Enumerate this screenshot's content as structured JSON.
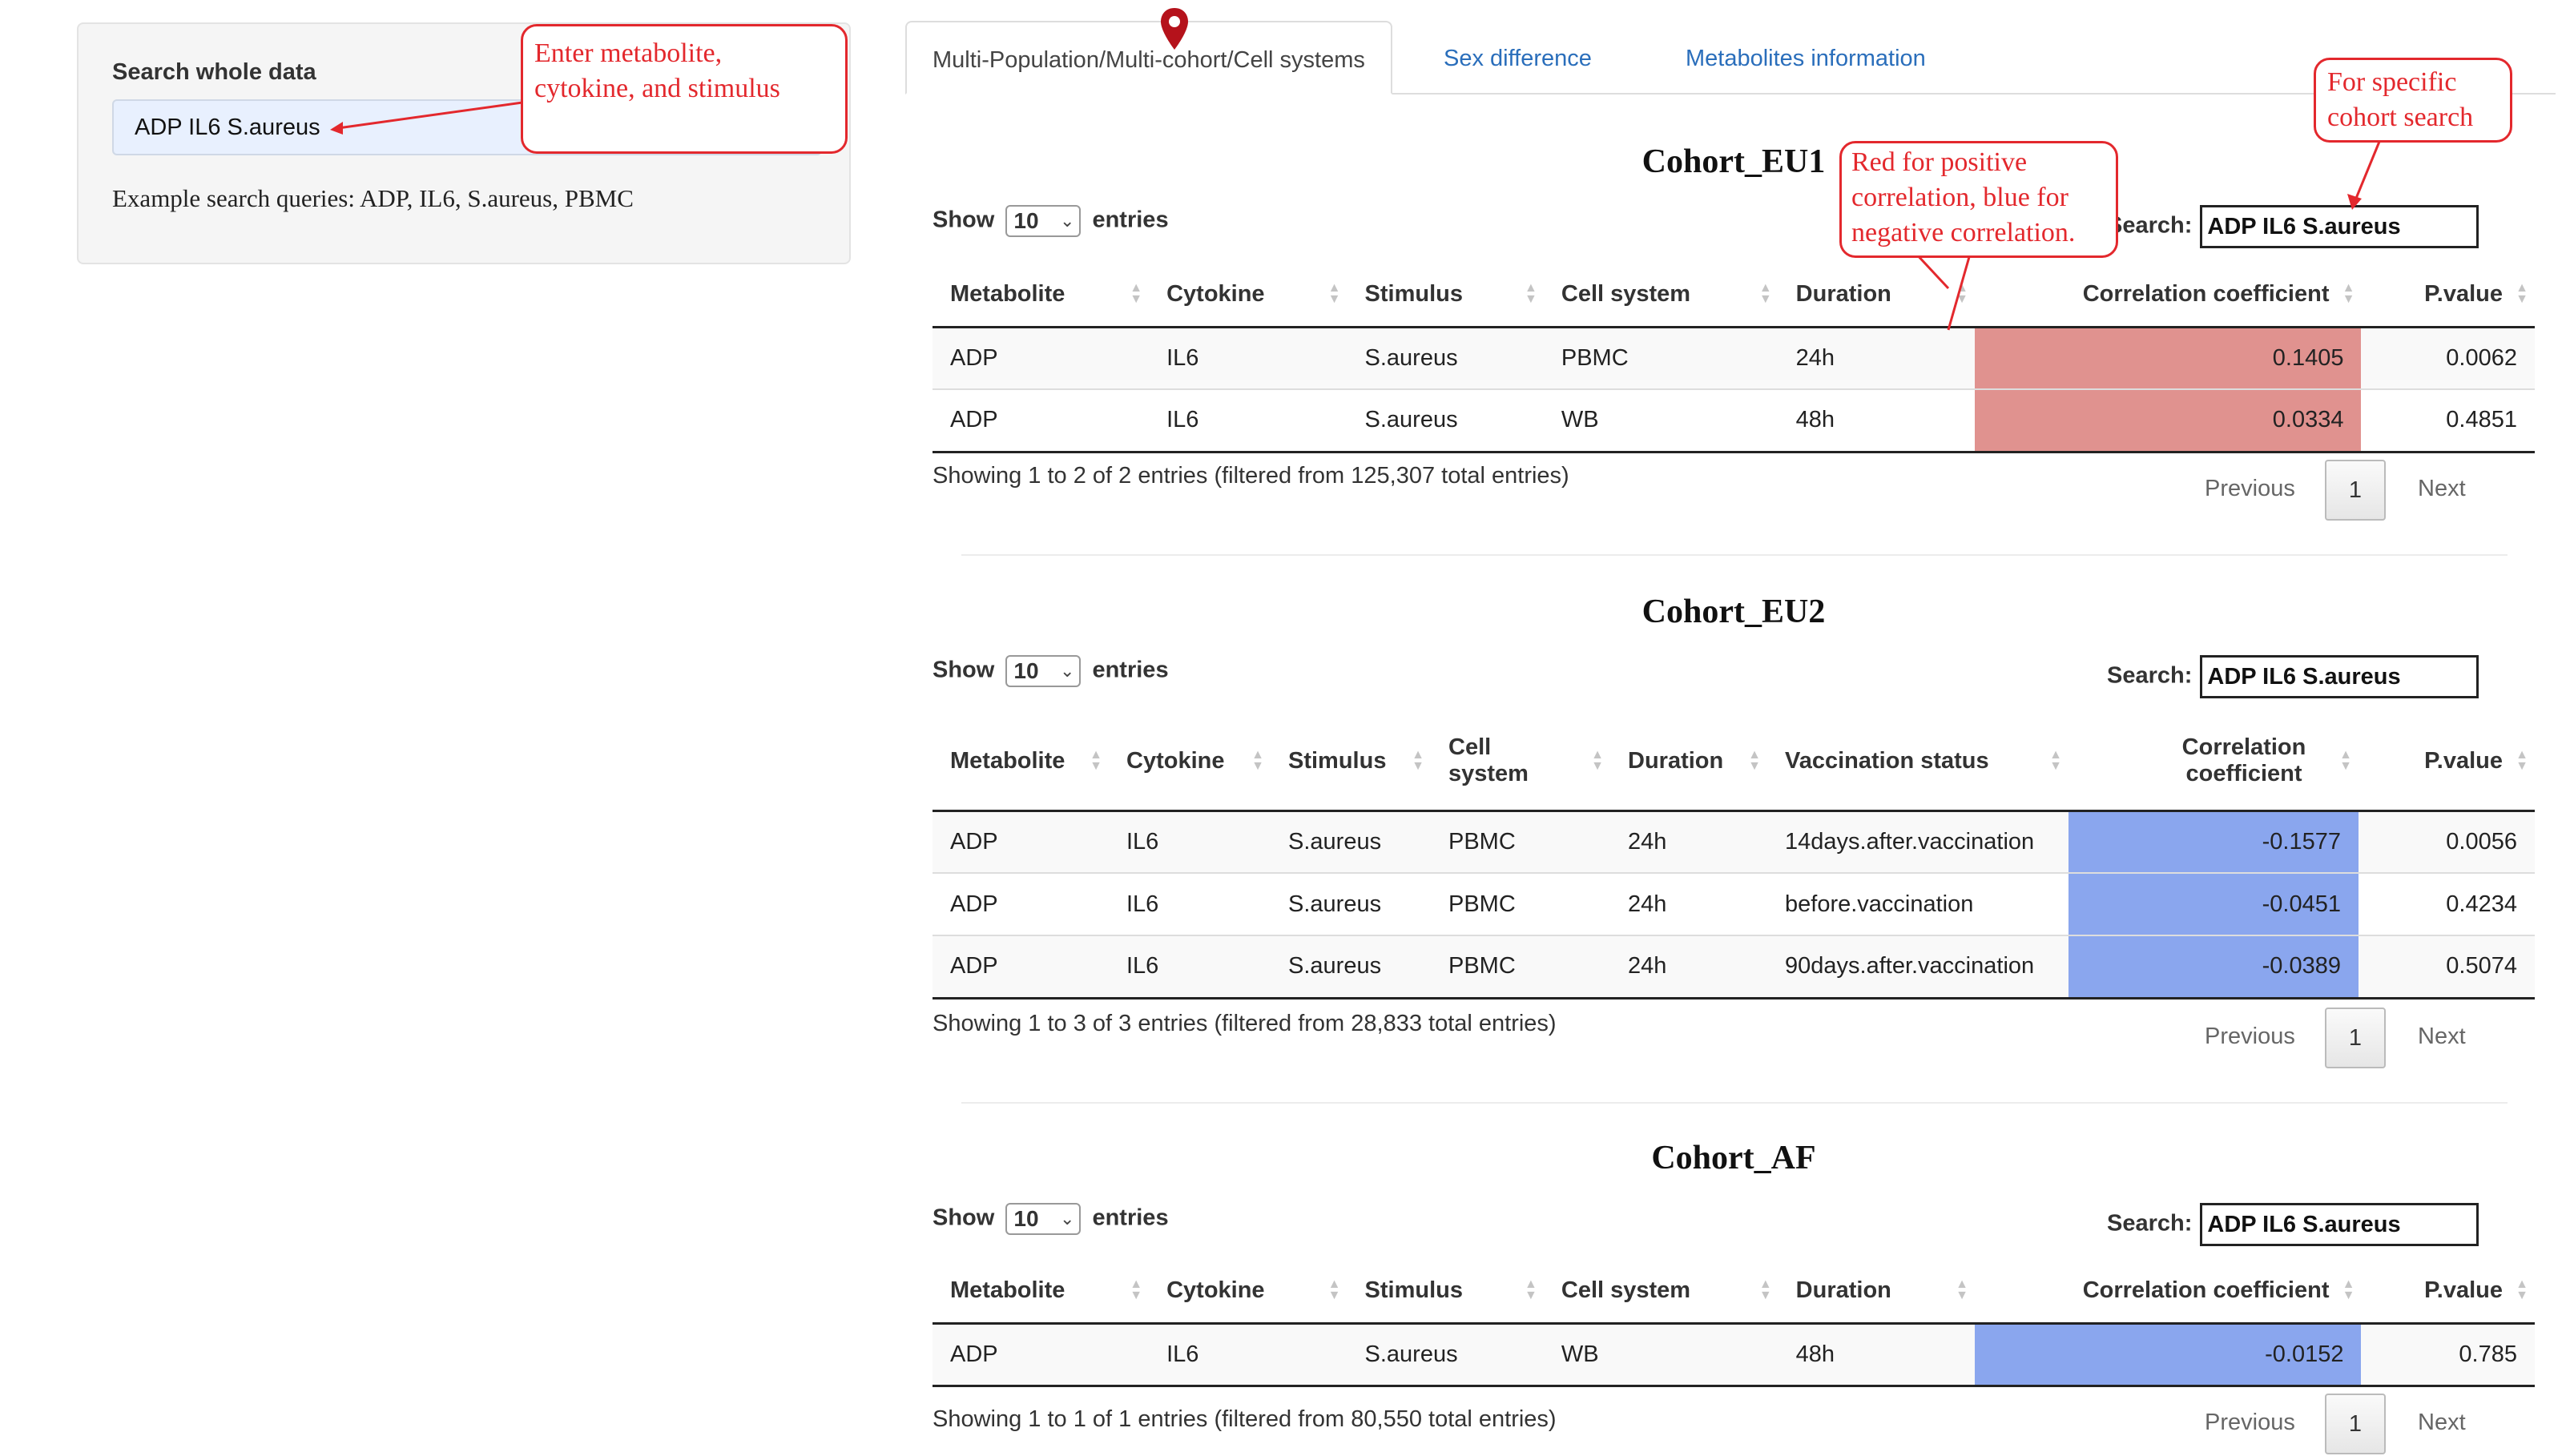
{
  "sidebar": {
    "label": "Search whole data",
    "input_value": "ADP IL6 S.aureus",
    "help_text": "Example search queries: ADP, IL6, S.aureus, PBMC"
  },
  "tabs": [
    {
      "label": "Multi-Population/Multi-cohort/Cell systems",
      "active": true
    },
    {
      "label": "Sex difference",
      "active": false
    },
    {
      "label": "Metabolites information",
      "active": false
    }
  ],
  "common": {
    "show_label": "Show",
    "entries_label": "entries",
    "page_size": "10",
    "search_label": "Search:",
    "prev_label": "Previous",
    "next_label": "Next",
    "page_number": "1"
  },
  "cohorts": [
    {
      "title": "Cohort_EU1",
      "search_value": "ADP IL6 S.aureus",
      "columns": [
        "Metabolite",
        "Cytokine",
        "Stimulus",
        "Cell system",
        "Duration",
        "Correlation coefficient",
        "P.value"
      ],
      "rows": [
        [
          "ADP",
          "IL6",
          "S.aureus",
          "PBMC",
          "24h",
          "0.1405",
          "0.0062"
        ],
        [
          "ADP",
          "IL6",
          "S.aureus",
          "WB",
          "48h",
          "0.0334",
          "0.4851"
        ]
      ],
      "info": "Showing 1 to 2 of 2 entries (filtered from 125,307 total entries)"
    },
    {
      "title": "Cohort_EU2",
      "search_value": "ADP IL6 S.aureus",
      "columns": [
        "Metabolite",
        "Cytokine",
        "Stimulus",
        "Cell system",
        "Duration",
        "Vaccination status",
        "Correlation coefficient",
        "P.value"
      ],
      "rows": [
        [
          "ADP",
          "IL6",
          "S.aureus",
          "PBMC",
          "24h",
          "14days.after.vaccination",
          "-0.1577",
          "0.0056"
        ],
        [
          "ADP",
          "IL6",
          "S.aureus",
          "PBMC",
          "24h",
          "before.vaccination",
          "-0.0451",
          "0.4234"
        ],
        [
          "ADP",
          "IL6",
          "S.aureus",
          "PBMC",
          "24h",
          "90days.after.vaccination",
          "-0.0389",
          "0.5074"
        ]
      ],
      "info": "Showing 1 to 3 of 3 entries (filtered from 28,833 total entries)"
    },
    {
      "title": "Cohort_AF",
      "search_value": "ADP IL6 S.aureus",
      "columns": [
        "Metabolite",
        "Cytokine",
        "Stimulus",
        "Cell system",
        "Duration",
        "Correlation coefficient",
        "P.value"
      ],
      "rows": [
        [
          "ADP",
          "IL6",
          "S.aureus",
          "WB",
          "48h",
          "-0.0152",
          "0.785"
        ]
      ],
      "info": "Showing 1 to 1 of 1 entries (filtered from 80,550 total entries)"
    }
  ],
  "annotations": {
    "sidebar_note": [
      "Enter metabolite,",
      "cytokine, and stimulus"
    ],
    "color_note": [
      "Red for positive",
      "correlation, blue for",
      "negative correlation."
    ],
    "cohort_note": [
      "For specific",
      "cohort search"
    ]
  },
  "colors": {
    "positive": "#e0928f",
    "negative": "#8aa6ee",
    "annotation": "#e3282d",
    "tab_link": "#2a6ebb"
  }
}
